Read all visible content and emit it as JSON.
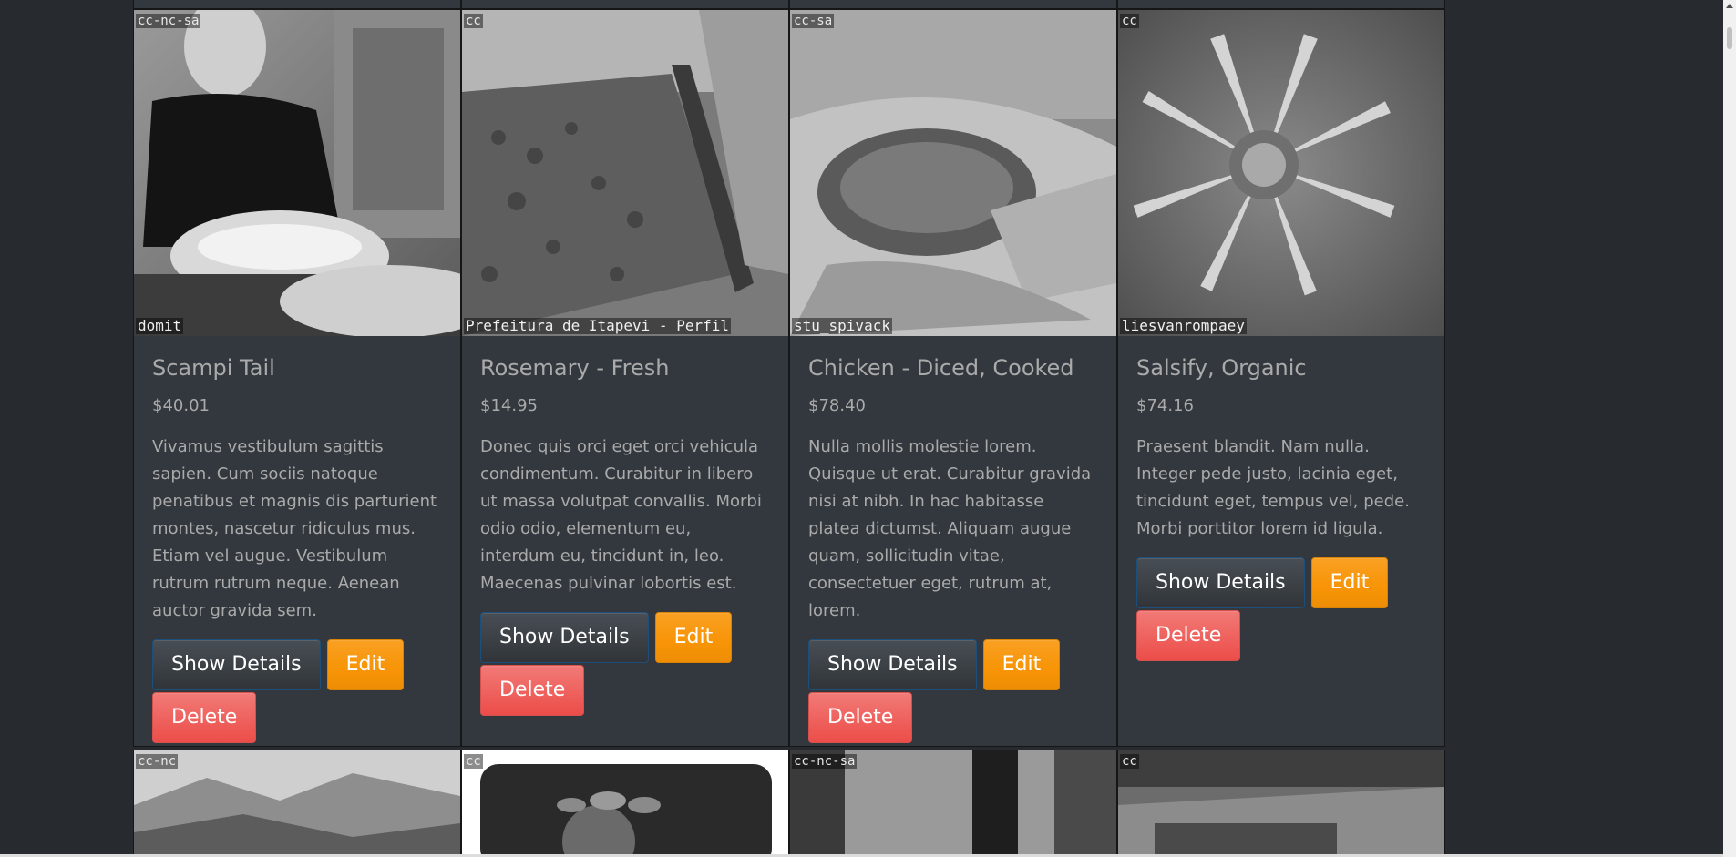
{
  "products": [
    {
      "title": "Scampi Tail",
      "price": "$40.01",
      "description": "Vivamus vestibulum sagittis sapien. Cum sociis natoque penatibus et magnis dis parturient montes, nascetur ridiculus mus. Etiam vel augue. Vestibulum rutrum rutrum neque. Aenean auctor gravida sem.",
      "license": "cc-nc-sa",
      "credit": "domit",
      "show_label": "Show Details",
      "edit_label": "Edit",
      "delete_label": "Delete"
    },
    {
      "title": "Rosemary - Fresh",
      "price": "$14.95",
      "description": "Donec quis orci eget orci vehicula condimentum. Curabitur in libero ut massa volutpat convallis. Morbi odio odio, elementum eu, interdum eu, tincidunt in, leo. Maecenas pulvinar lobortis est.",
      "license": "cc",
      "credit": "Prefeitura de Itapevi - Perfil",
      "show_label": "Show Details",
      "edit_label": "Edit",
      "delete_label": "Delete"
    },
    {
      "title": "Chicken - Diced, Cooked",
      "price": "$78.40",
      "description": "Nulla mollis molestie lorem. Quisque ut erat. Curabitur gravida nisi at nibh. In hac habitasse platea dictumst. Aliquam augue quam, sollicitudin vitae, consectetuer eget, rutrum at, lorem.",
      "license": "cc-sa",
      "credit": "stu_spivack",
      "show_label": "Show Details",
      "edit_label": "Edit",
      "delete_label": "Delete"
    },
    {
      "title": "Salsify, Organic",
      "price": "$74.16",
      "description": "Praesent blandit. Nam nulla. Integer pede justo, lacinia eget, tincidunt eget, tempus vel, pede. Morbi porttitor lorem id ligula.",
      "license": "cc",
      "credit": "liesvanrompaey",
      "show_label": "Show Details",
      "edit_label": "Edit",
      "delete_label": "Delete"
    }
  ],
  "next_row": [
    {
      "license": "cc-nc"
    },
    {
      "license": "cc"
    },
    {
      "license": "cc-nc-sa"
    },
    {
      "license": "cc"
    }
  ],
  "colors": {
    "background": "#272b30",
    "card": "#32383e",
    "text": "#aaaaaa",
    "edit": "#f89406",
    "delete": "#ee5f5b",
    "show": "#3a3f44"
  }
}
